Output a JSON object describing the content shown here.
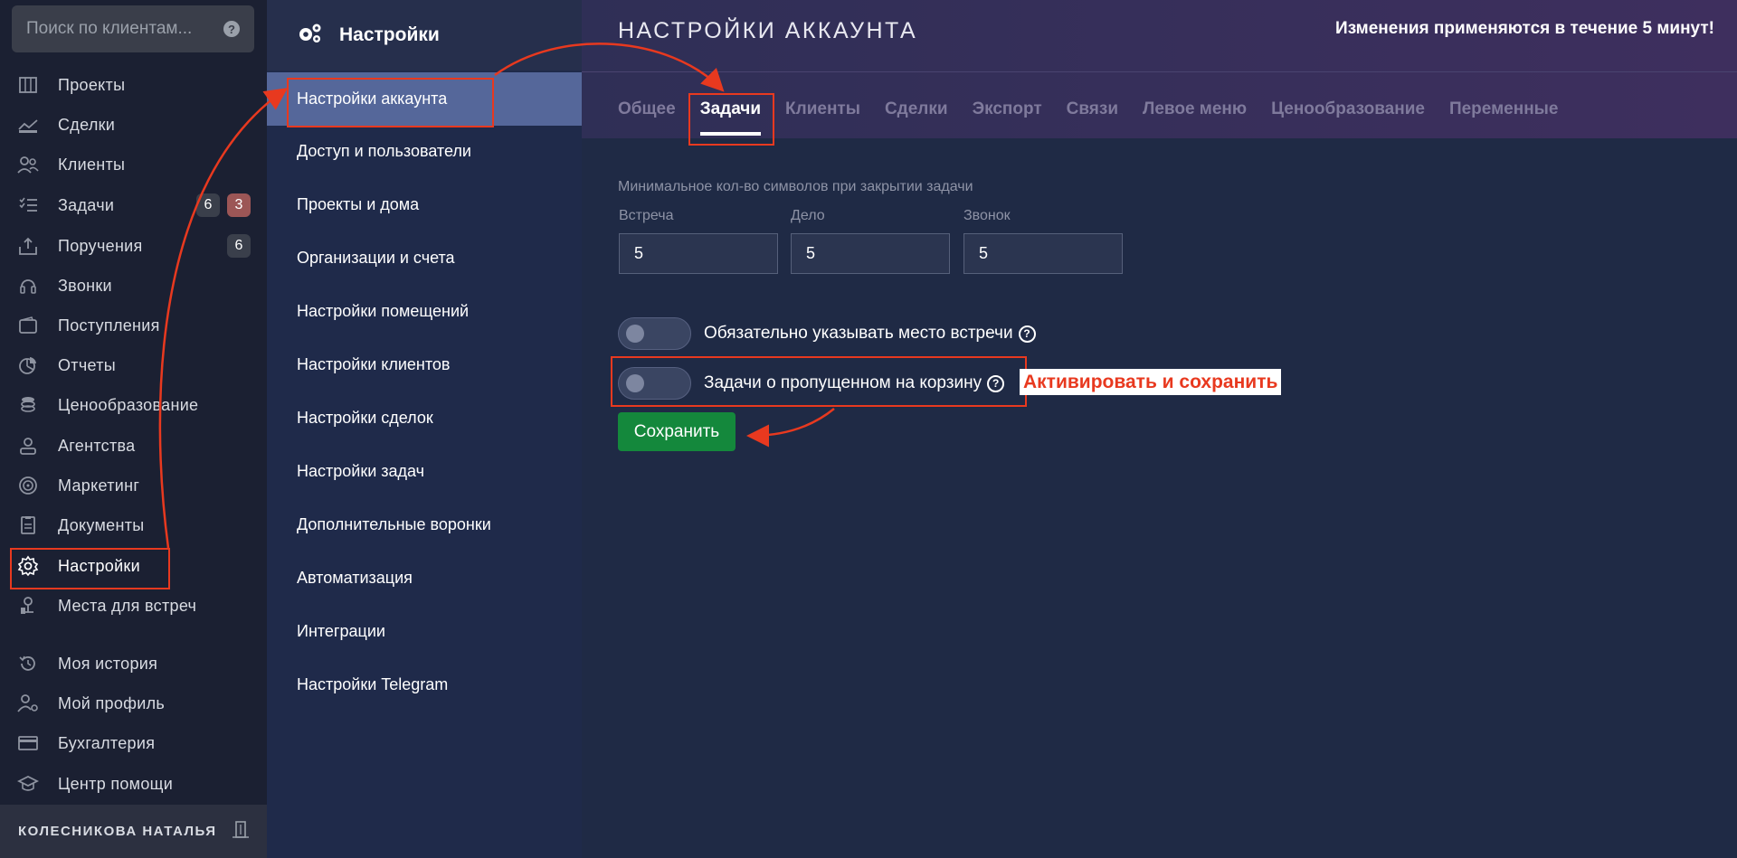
{
  "search": {
    "placeholder": "Поиск по клиентам...",
    "help": "?"
  },
  "nav": {
    "items": [
      {
        "label": "Проекты",
        "icon": "projects-icon"
      },
      {
        "label": "Сделки",
        "icon": "deals-icon"
      },
      {
        "label": "Клиенты",
        "icon": "clients-icon"
      },
      {
        "label": "Задачи",
        "icon": "tasks-icon",
        "badge": "6",
        "badge2": "3"
      },
      {
        "label": "Поручения",
        "icon": "assignments-icon",
        "badge": "6"
      },
      {
        "label": "Звонки",
        "icon": "calls-icon"
      },
      {
        "label": "Поступления",
        "icon": "wallet-icon"
      },
      {
        "label": "Отчеты",
        "icon": "reports-icon"
      },
      {
        "label": "Ценообразование",
        "icon": "pricing-icon"
      },
      {
        "label": "Агентства",
        "icon": "agencies-icon"
      },
      {
        "label": "Маркетинг",
        "icon": "target-icon"
      },
      {
        "label": "Документы",
        "icon": "documents-icon"
      },
      {
        "label": "Настройки",
        "icon": "gear-icon"
      },
      {
        "label": "Места для встреч",
        "icon": "meeting-places-icon"
      },
      {
        "label": "Моя история",
        "icon": "history-icon"
      },
      {
        "label": "Мой профиль",
        "icon": "profile-settings-icon"
      },
      {
        "label": "Бухгалтерия",
        "icon": "card-icon"
      },
      {
        "label": "Центр помощи",
        "icon": "graduation-icon"
      }
    ],
    "user": "КОЛЕСНИКОВА НАТАЛЬЯ"
  },
  "settings_menu": {
    "title": "Настройки",
    "items": [
      "Настройки аккаунта",
      "Доступ и пользователи",
      "Проекты и дома",
      "Организации и счета",
      "Настройки помещений",
      "Настройки клиентов",
      "Настройки сделок",
      "Настройки задач",
      "Дополнительные воронки",
      "Автоматизация",
      "Интеграции",
      "Настройки Telegram"
    ]
  },
  "main": {
    "title": "НАСТРОЙКИ АККАУНТА",
    "notice": "Изменения применяются в течение 5 минут!",
    "tabs": [
      "Общее",
      "Задачи",
      "Клиенты",
      "Сделки",
      "Экспорт",
      "Связи",
      "Левое меню",
      "Ценообразование",
      "Переменные"
    ],
    "fieldset_label": "Минимальное кол-во символов при закрытии задачи",
    "fields": [
      {
        "label": "Встреча",
        "value": "5"
      },
      {
        "label": "Дело",
        "value": "5"
      },
      {
        "label": "Звонок",
        "value": "5"
      }
    ],
    "toggle1": "Обязательно указывать место встречи",
    "toggle2": "Задачи о пропущенном на корзину",
    "qmark": "?",
    "save": "Сохранить"
  },
  "annotation": "Активировать и сохранить",
  "colors": {
    "accent_red": "#e8391f",
    "save_green": "#14883c",
    "active_item": "#55679a"
  }
}
